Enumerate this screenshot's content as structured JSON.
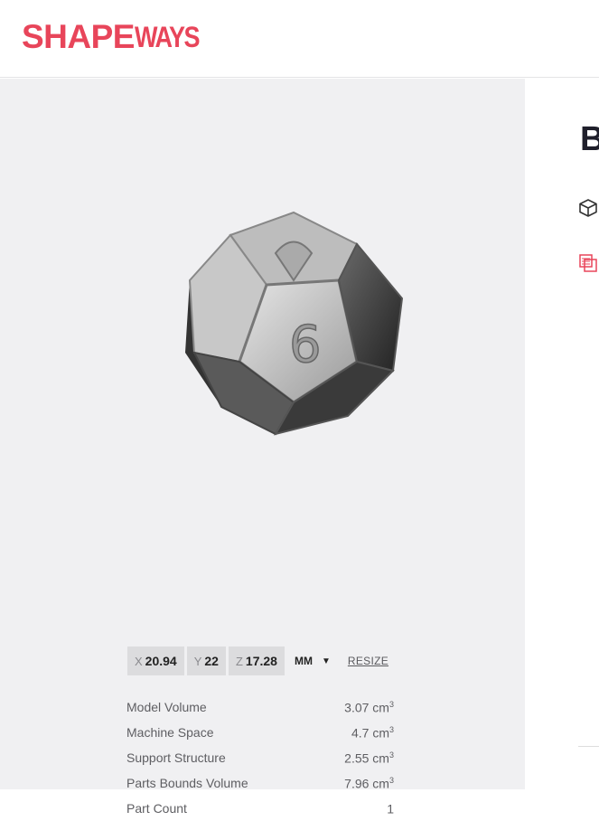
{
  "brand": {
    "logo_main": "SHAPE",
    "logo_sub": "WAYS",
    "color": "#e8455a"
  },
  "viewer": {
    "dimensions": [
      {
        "axis": "X",
        "value": "20.94"
      },
      {
        "axis": "Y",
        "value": "22"
      },
      {
        "axis": "Z",
        "value": "17.28"
      }
    ],
    "unit": "MM",
    "resize_label": "RESIZE",
    "stats": [
      {
        "label": "Model Volume",
        "value": "3.07 cm",
        "sup": "3"
      },
      {
        "label": "Machine Space",
        "value": "4.7 cm",
        "sup": "3"
      },
      {
        "label": "Support Structure",
        "value": "2.55 cm",
        "sup": "3"
      },
      {
        "label": "Parts Bounds Volume",
        "value": "7.96 cm",
        "sup": "3"
      },
      {
        "label": "Part Count",
        "value": "1",
        "sup": ""
      }
    ]
  },
  "right_panel": {
    "title_partial": "B",
    "icons": [
      "cube-icon",
      "material-swatch-icon"
    ]
  }
}
